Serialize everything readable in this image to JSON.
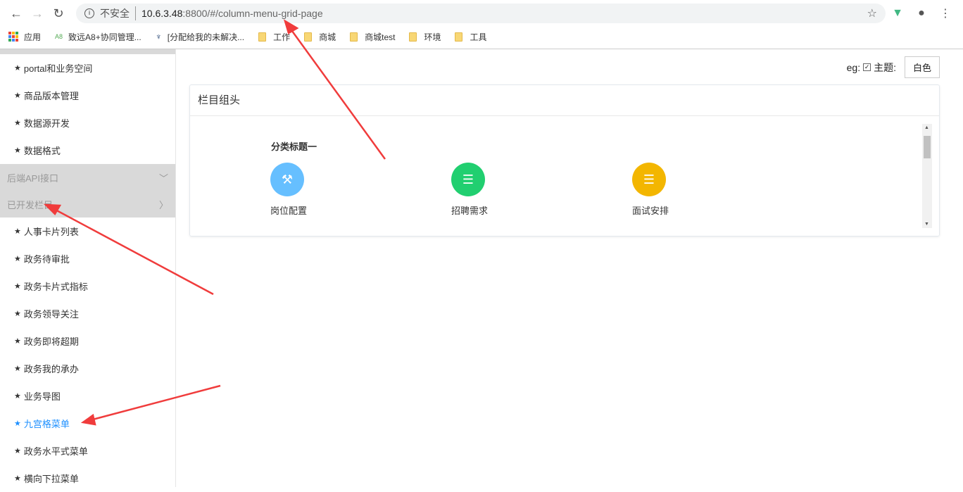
{
  "browser": {
    "security": "不安全",
    "host": "10.6.3.48",
    "path": ":8800/#/column-menu-grid-page",
    "bookmarks": [
      "应用",
      "致远A8+协同管理...",
      "[分配给我的未解决...",
      "工作",
      "商城",
      "商城test",
      "环境",
      "工具"
    ]
  },
  "sidebar": {
    "items_top": [
      "portal和业务空间",
      "商品版本管理",
      "数据源开发",
      "数据格式"
    ],
    "groups": [
      "后端API接口",
      "已开发栏目"
    ],
    "items": [
      "人事卡片列表",
      "政务待审批",
      "政务卡片式指标",
      "政务领导关注",
      "政务即将超期",
      "政务我的承办",
      "业务导图",
      "九宫格菜单",
      "政务水平式菜单",
      "横向下拉菜单"
    ],
    "active": "九宫格菜单"
  },
  "theme": {
    "eg": "eg:",
    "label": "主题:",
    "button": "白色",
    "checked": true
  },
  "card": {
    "title": "栏目组头",
    "category": "分类标题一",
    "items": [
      {
        "label": "岗位配置",
        "color": "#66bfff",
        "icon": "gavel-icon"
      },
      {
        "label": "招聘需求",
        "color": "#21cf70",
        "icon": "layers-icon"
      },
      {
        "label": "面试安排",
        "color": "#f3b600",
        "icon": "layers-icon"
      }
    ]
  }
}
